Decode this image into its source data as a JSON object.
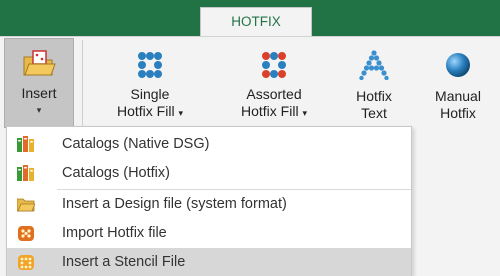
{
  "tab": {
    "label": "HOTFIX"
  },
  "ribbon": {
    "insert": {
      "label": "Insert"
    },
    "single": {
      "line1": "Single",
      "line2": "Hotfix Fill"
    },
    "assorted": {
      "line1": "Assorted",
      "line2": "Hotfix Fill"
    },
    "text": {
      "line1": "Hotfix",
      "line2": "Text"
    },
    "manual": {
      "line1": "Manual",
      "line2": "Hotfix"
    },
    "dropdown_glyph": "▾"
  },
  "menu": {
    "items": [
      {
        "label": "Catalogs (Native DSG)",
        "icon": "catalog-icon"
      },
      {
        "label": "Catalogs (Hotfix)",
        "icon": "catalog-icon"
      },
      {
        "label": "Insert a Design file (system format)",
        "icon": "folder-icon"
      },
      {
        "label": "Import Hotfix file",
        "icon": "hotfix-file-icon"
      },
      {
        "label": "Insert a Stencil File",
        "icon": "stencil-icon",
        "highlighted": true
      }
    ]
  },
  "colors": {
    "accent": "#217346",
    "highlight": "#d7d7d7",
    "blue": "#2a7fbf",
    "red": "#d9412b"
  }
}
